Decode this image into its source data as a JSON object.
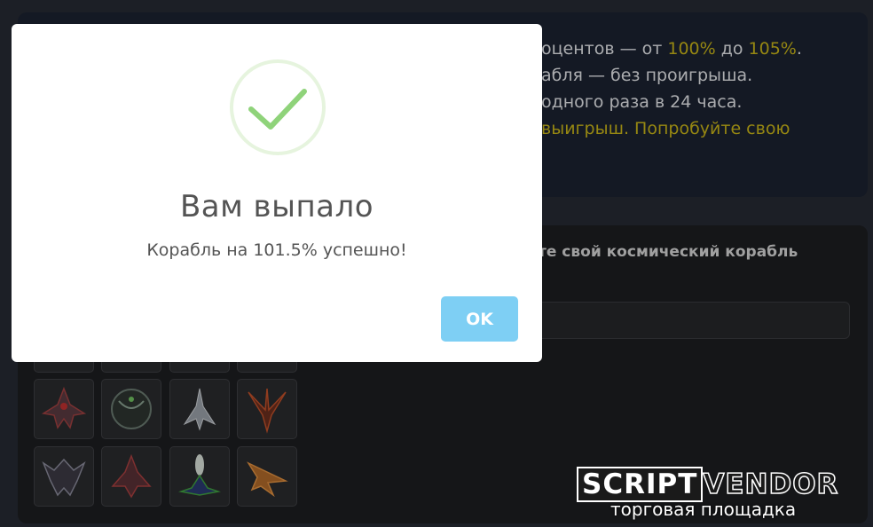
{
  "info": {
    "line1_text": "оцентов — от ",
    "line1_min": "100%",
    "line1_mid": " до ",
    "line1_max": "105%",
    "line1_end": ".",
    "line2": "абля — без проигрыша.",
    "line3": "одного раза в 24 часа.",
    "line4": "выигрыш. Попробуйте свою"
  },
  "ships_section": {
    "title": "те свой космический корабль"
  },
  "modal": {
    "title": "Вам выпало",
    "message": "Корабль на 101.5% успешно!",
    "ok_label": "OK",
    "icon": "checkmark-icon"
  },
  "watermark": {
    "brand_part1": "SCRIPT",
    "brand_part2": "VENDOR",
    "subtitle": "торговая площадка"
  },
  "colors": {
    "accent_yellow": "#c8b419",
    "ok_button": "#7ecff4",
    "success_green": "#8fd37a"
  }
}
